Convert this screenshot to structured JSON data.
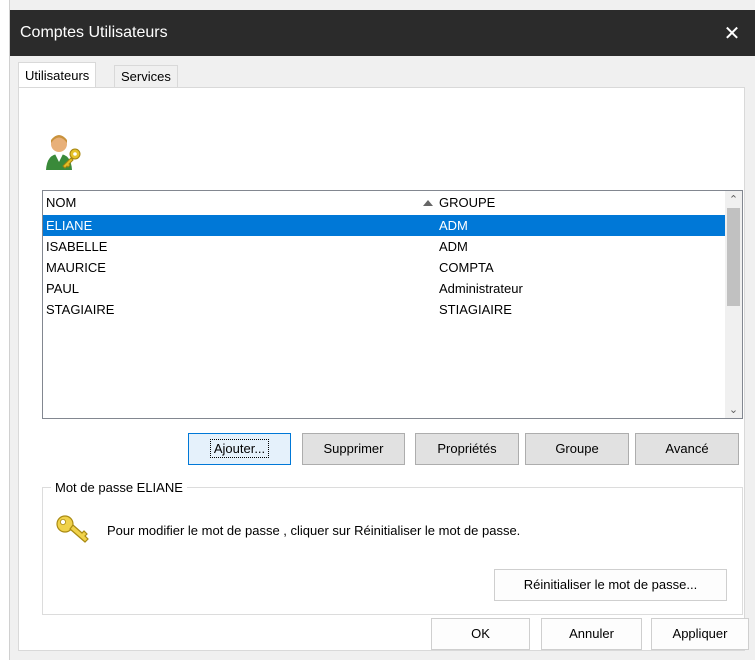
{
  "window": {
    "title": "Comptes Utilisateurs",
    "close_glyph": "✕"
  },
  "tabs": [
    {
      "label": "Utilisateurs",
      "active": true
    },
    {
      "label": "Services",
      "active": false
    }
  ],
  "icons": {
    "users": "user-key-icon",
    "password": "key-icon"
  },
  "list": {
    "columns": {
      "nom": "NOM",
      "groupe": "GROUPE"
    },
    "sort_column": "groupe",
    "rows": [
      {
        "nom": "ELIANE",
        "groupe": "ADM",
        "selected": true
      },
      {
        "nom": "ISABELLE",
        "groupe": "ADM",
        "selected": false
      },
      {
        "nom": "MAURICE",
        "groupe": "COMPTA",
        "selected": false
      },
      {
        "nom": "PAUL",
        "groupe": "Administrateur",
        "selected": false
      },
      {
        "nom": "STAGIAIRE",
        "groupe": "STIAGIAIRE",
        "selected": false
      }
    ]
  },
  "actions": {
    "add": "Ajouter...",
    "delete": "Supprimer",
    "properties": "Propriétés",
    "group": "Groupe",
    "advanced": "Avancé"
  },
  "password": {
    "group_title": "Mot de passe ELIANE",
    "instructions": "Pour modifier le mot de passe , cliquer sur  Réinitialiser le mot de passe.",
    "reset_button": "Réinitialiser le mot de passe..."
  },
  "footer": {
    "ok": "OK",
    "cancel": "Annuler",
    "apply": "Appliquer"
  },
  "colors": {
    "titlebar": "#2b2b2b",
    "selection": "#0078d7"
  }
}
